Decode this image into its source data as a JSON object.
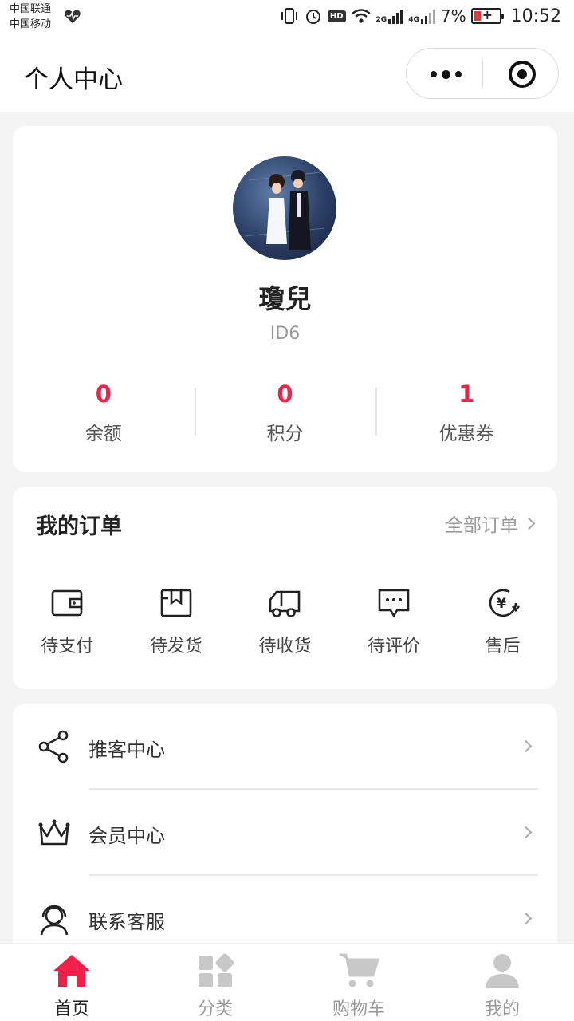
{
  "status_bar": {
    "carrier_1": "中国联通",
    "carrier_2": "中国移动",
    "hd_badge": "HD",
    "signal_1": "2G",
    "signal_2": "4G",
    "battery_percent": "7%",
    "time": "10:52"
  },
  "nav": {
    "title": "个人中心"
  },
  "profile": {
    "name": "瓊兒",
    "id": "ID6",
    "stats": [
      {
        "value": "0",
        "label": "余额"
      },
      {
        "value": "0",
        "label": "积分"
      },
      {
        "value": "1",
        "label": "优惠券"
      }
    ]
  },
  "orders": {
    "title": "我的订单",
    "all_link": "全部订单",
    "items": [
      {
        "label": "待支付",
        "icon": "wallet-icon"
      },
      {
        "label": "待发货",
        "icon": "package-icon"
      },
      {
        "label": "待收货",
        "icon": "truck-icon"
      },
      {
        "label": "待评价",
        "icon": "comment-icon"
      },
      {
        "label": "售后",
        "icon": "refund-icon"
      }
    ]
  },
  "menu": {
    "items": [
      {
        "label": "推客中心",
        "icon": "share-icon"
      },
      {
        "label": "会员中心",
        "icon": "crown-icon"
      },
      {
        "label": "联系客服",
        "icon": "headset-icon"
      }
    ]
  },
  "tabbar": {
    "items": [
      {
        "label": "首页",
        "icon": "home-icon",
        "active": true
      },
      {
        "label": "分类",
        "icon": "category-icon",
        "active": false
      },
      {
        "label": "购物车",
        "icon": "cart-icon",
        "active": false
      },
      {
        "label": "我的",
        "icon": "user-icon",
        "active": false
      }
    ]
  },
  "colors": {
    "accent": "#f0204a",
    "background": "#f4f4f4",
    "card": "#ffffff",
    "inactive_tab": "#c8c8c8"
  }
}
